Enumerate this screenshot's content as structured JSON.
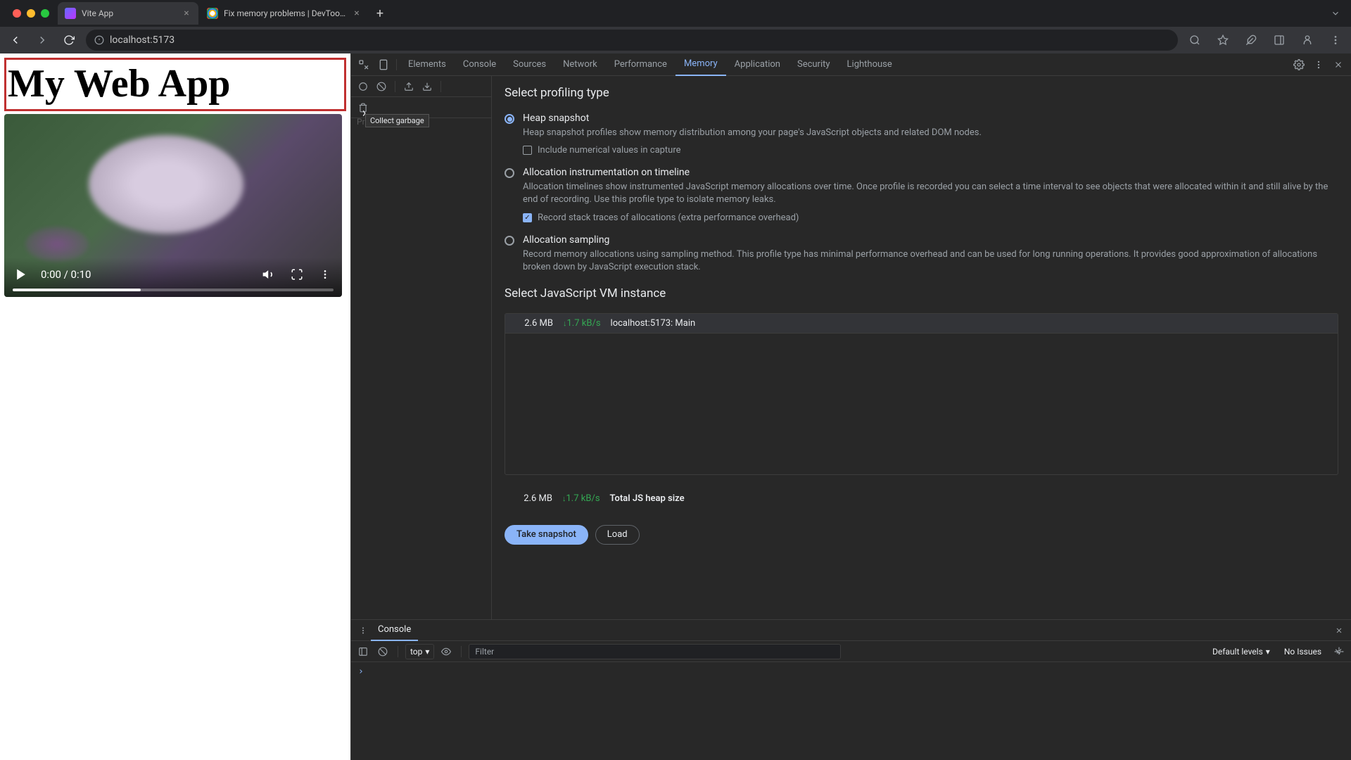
{
  "browser": {
    "tabs": [
      {
        "title": "Vite App",
        "active": true
      },
      {
        "title": "Fix memory problems  |  DevTools",
        "active": false
      }
    ],
    "url": "localhost:5173"
  },
  "page": {
    "app_title": "My Web App",
    "video_time": "0:00 / 0:10"
  },
  "devtools": {
    "tabs": [
      "Elements",
      "Console",
      "Sources",
      "Network",
      "Performance",
      "Memory",
      "Application",
      "Security",
      "Lighthouse"
    ],
    "active_tab": "Memory",
    "gc_tooltip": "Collect garbage",
    "profiles_label": "Profiles",
    "memory": {
      "section1_title": "Select profiling type",
      "options": [
        {
          "label": "Heap snapshot",
          "desc": "Heap snapshot profiles show memory distribution among your page's JavaScript objects and related DOM nodes.",
          "checked": true,
          "sub_checkbox": {
            "label": "Include numerical values in capture",
            "checked": false
          }
        },
        {
          "label": "Allocation instrumentation on timeline",
          "desc": "Allocation timelines show instrumented JavaScript memory allocations over time. Once profile is recorded you can select a time interval to see objects that were allocated within it and still alive by the end of recording. Use this profile type to isolate memory leaks.",
          "checked": false,
          "sub_checkbox": {
            "label": "Record stack traces of allocations (extra performance overhead)",
            "checked": true
          }
        },
        {
          "label": "Allocation sampling",
          "desc": "Record memory allocations using sampling method. This profile type has minimal performance overhead and can be used for long running operations. It provides good approximation of allocations broken down by JavaScript execution stack.",
          "checked": false
        }
      ],
      "section2_title": "Select JavaScript VM instance",
      "vm": {
        "mem": "2.6 MB",
        "delta": "1.7 kB/s",
        "name": "localhost:5173: Main"
      },
      "total": {
        "mem": "2.6 MB",
        "delta": "1.7 kB/s",
        "label": "Total JS heap size"
      },
      "take_snapshot": "Take snapshot",
      "load": "Load"
    },
    "drawer": {
      "tab": "Console",
      "context": "top",
      "filter_placeholder": "Filter",
      "levels": "Default levels",
      "issues": "No Issues"
    }
  }
}
